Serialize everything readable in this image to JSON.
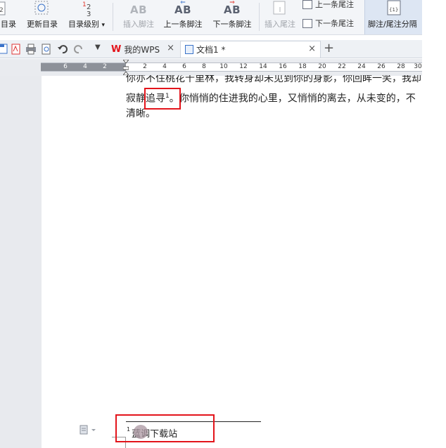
{
  "ribbon": {
    "toc_label": "目录",
    "update_toc_label": "更新目录",
    "toc_level_label": "目录级别",
    "toc_level_dropdown": "▾",
    "insert_footnote_label": "插入脚注",
    "prev_footnote_label": "上一条脚注",
    "next_footnote_label": "下一条脚注",
    "insert_endnote_label": "插入尾注",
    "prev_endnote_label": "上一条尾注",
    "next_endnote_label": "下一条尾注",
    "separator_label": "脚注/尾注分隔",
    "ab_glyph": "AB",
    "level_digits": "1 2 3",
    "separator_icon_text": "{1}"
  },
  "tabs": {
    "my_wps": "我的WPS",
    "doc": "文档1 *",
    "close": "×",
    "new_tab": "+"
  },
  "ruler": {
    "left_numbers": [
      "6",
      "4",
      "2"
    ],
    "right_numbers": [
      "2",
      "4",
      "6",
      "8",
      "10",
      "12",
      "14",
      "16",
      "18",
      "20",
      "22",
      "24",
      "26",
      "28",
      "30"
    ]
  },
  "document": {
    "line1": "你亦不住桃花千里林，我转身却未见到你的身影，你回眸一笑，我却",
    "line2_before": "寂静",
    "line2_marked": "追寻",
    "footnote_ref": "1",
    "line2_after": "。你悄悄的住进我的心里，又悄悄的离去，从未变的，不",
    "line3": "清晰。"
  },
  "footnote": {
    "number": "1",
    "text": "蓝调下载站"
  },
  "colors": {
    "highlight_red": "#e3141b",
    "ribbon_bg": "#f3f5f8",
    "active_button_bg": "#dde6f3"
  }
}
